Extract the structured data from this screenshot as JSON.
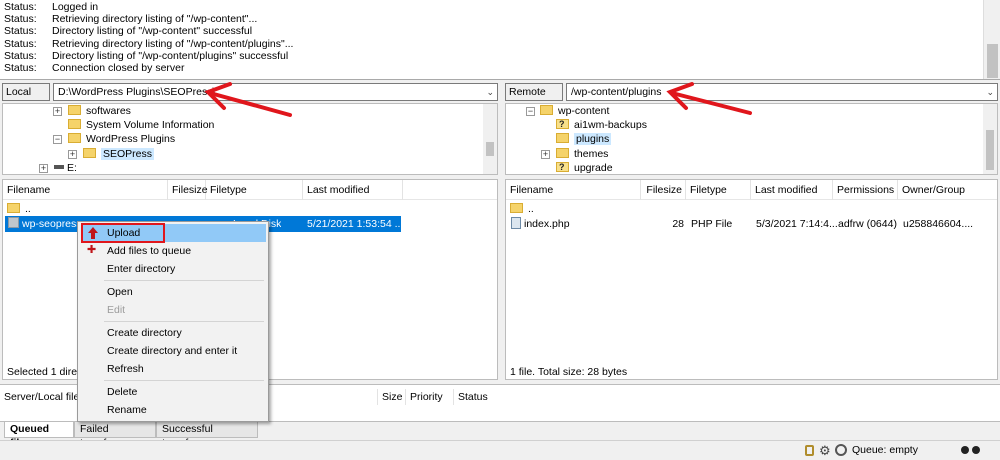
{
  "log": [
    {
      "label": "Status:",
      "text": "Logged in"
    },
    {
      "label": "Status:",
      "text": "Retrieving directory listing of \"/wp-content\"..."
    },
    {
      "label": "Status:",
      "text": "Directory listing of \"/wp-content\" successful"
    },
    {
      "label": "Status:",
      "text": "Retrieving directory listing of \"/wp-content/plugins\"..."
    },
    {
      "label": "Status:",
      "text": "Directory listing of \"/wp-content/plugins\" successful"
    },
    {
      "label": "Status:",
      "text": "Connection closed by server"
    }
  ],
  "local": {
    "site_label": "Local site:",
    "path": "D:\\WordPress Plugins\\SEOPress\\",
    "tree": [
      "softwares",
      "System Volume Information",
      "WordPress Plugins",
      "SEOPress",
      "E:"
    ],
    "columns": [
      "Filename",
      "Filesize",
      "Filetype",
      "Last modified"
    ],
    "rows": [
      {
        "name": "..",
        "size": "",
        "type": "",
        "modified": ""
      },
      {
        "name": "wp-seopress",
        "size": "",
        "type": "Local Disk",
        "modified": "5/21/2021 1:53:54 ..."
      }
    ],
    "status": "Selected 1 directory"
  },
  "remote": {
    "site_label": "Remote site:",
    "path": "/wp-content/plugins",
    "tree": [
      "wp-content",
      "ai1wm-backups",
      "plugins",
      "themes",
      "upgrade"
    ],
    "columns": [
      "Filename",
      "Filesize",
      "Filetype",
      "Last modified",
      "Permissions",
      "Owner/Group"
    ],
    "rows": [
      {
        "name": "..",
        "size": "",
        "type": "",
        "modified": "",
        "perms": "",
        "owner": ""
      },
      {
        "name": "index.php",
        "size": "28",
        "type": "PHP File",
        "modified": "5/3/2021 7:14:4...",
        "perms": "adfrw (0644)",
        "owner": "u258846604...."
      }
    ],
    "status": "1 file. Total size: 28 bytes"
  },
  "context_menu": {
    "items": [
      "Upload",
      "Add files to queue",
      "Enter directory",
      "Open",
      "Edit",
      "Create directory",
      "Create directory and enter it",
      "Refresh",
      "Delete",
      "Rename"
    ]
  },
  "queue": {
    "columns": [
      "Server/Local file",
      "Size",
      "Priority",
      "Status"
    ],
    "tabs": [
      "Queued files",
      "Failed transfers",
      "Successful transfers"
    ]
  },
  "statusbar": {
    "queue": "Queue: empty"
  },
  "colors": {
    "selection": "#0078d7",
    "menu_highlight": "#91c9f7",
    "annotation": "#e0161c"
  }
}
